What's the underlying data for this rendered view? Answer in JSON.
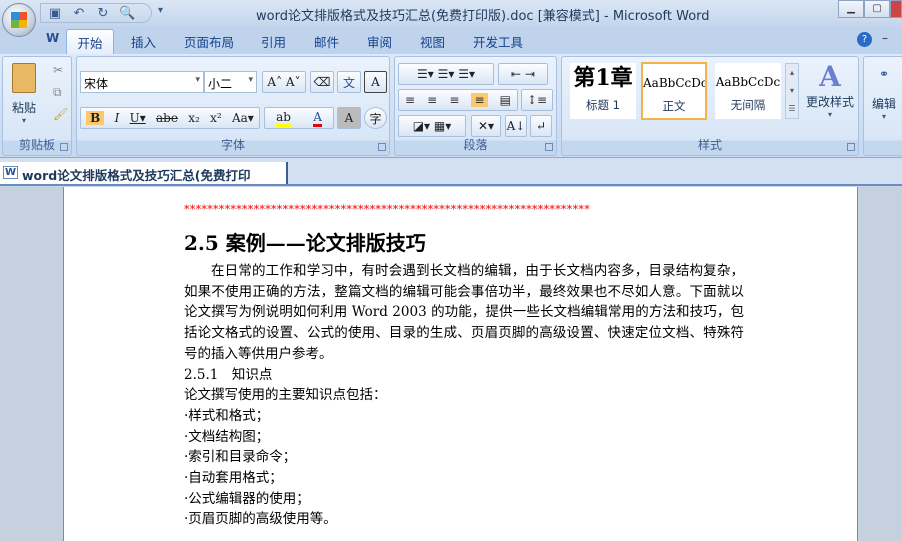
{
  "window": {
    "title": "word论文排版格式及技巧汇总(免费打印版).doc [兼容模式] - Microsoft Word"
  },
  "tabs": [
    "开始",
    "插入",
    "页面布局",
    "引用",
    "邮件",
    "审阅",
    "视图",
    "开发工具"
  ],
  "groups": {
    "clipboard": "剪贴板",
    "font": "字体",
    "paragraph": "段落",
    "styles": "样式",
    "editing": "编辑"
  },
  "clipboard": {
    "paste": "粘贴"
  },
  "font": {
    "name": "宋体",
    "size": "小二"
  },
  "styles": [
    {
      "preview": "第1章",
      "name": "标题 1"
    },
    {
      "preview": "AaBbCcDc",
      "name": "正文"
    },
    {
      "preview": "AaBbCcDc",
      "name": "无间隔"
    }
  ],
  "change_styles": "更改样式",
  "editing": "编辑",
  "doc_tab": "word论文排版格式及技巧汇总(免费打印版).doc",
  "document": {
    "stars": "**********************************************************************",
    "heading": "2.5 案例——论文排版技巧",
    "paragraph": "在日常的工作和学习中，有时会遇到长文档的编辑，由于长文档内容多，目录结构复杂，如果不使用正确的方法，整篇文档的编辑可能会事倍功半，最终效果也不尽如人意。下面就以论文撰写为例说明如何利用 Word 2003 的功能，提供一些长文档编辑常用的方法和技巧，包括论文格式的设置、公式的使用、目录的生成、页眉页脚的高级设置、快速定位文档、特殊符号的插入等供用户参考。",
    "subheading": "2.5.1　知识点",
    "intro": "论文撰写使用的主要知识点包括：",
    "items": [
      "·样式和格式；",
      "·文档结构图；",
      "·索引和目录命令；",
      "·自动套用格式；",
      "·公式编辑器的使用；",
      "·页眉页脚的高级使用等。"
    ]
  }
}
